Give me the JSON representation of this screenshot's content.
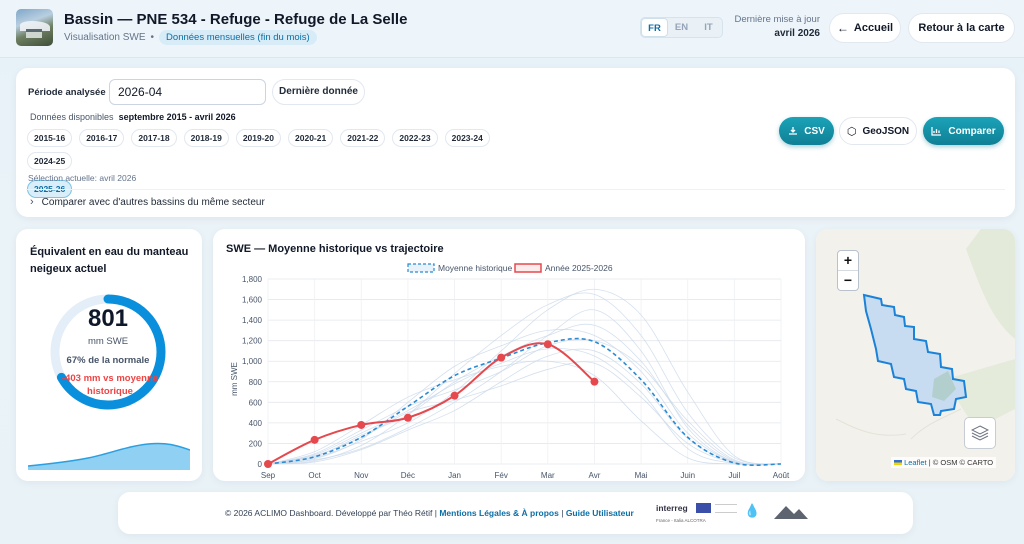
{
  "header": {
    "title": "Bassin — PNE 534 - Refuge - Refuge de La Selle",
    "subtitle": "Visualisation SWE",
    "subtitle_sep": "•",
    "mode_pill": "Données mensuelles (fin du mois)",
    "languages": [
      "FR",
      "EN",
      "IT"
    ],
    "active_language": "FR",
    "update_label": "Dernière mise à jour",
    "update_value": "avril 2026",
    "home_button": "Accueil",
    "back_button": "Retour à la carte"
  },
  "period": {
    "label": "Période analysée",
    "value": "2026-04",
    "last_data_button": "Dernière donnée",
    "available_label": "Données disponibles",
    "available_value": "septembre 2015 - avril 2026",
    "years": [
      "2015-16",
      "2016-17",
      "2017-18",
      "2018-19",
      "2019-20",
      "2020-21",
      "2021-22",
      "2022-23",
      "2023-24",
      "2024-25",
      "2025-26"
    ],
    "active_year": "2025-26",
    "selection_text": "Sélection actuelle: avril 2026",
    "compare_link": "Comparer avec d'autres bassins du même secteur",
    "csv_button": "CSV",
    "geojson_button": "GeoJSON",
    "compare_button": "Comparer"
  },
  "swe": {
    "title": "Équivalent en eau du manteau neigeux actuel",
    "value": "801",
    "unit": "mm SWE",
    "percent_normal": "67% de la normale",
    "gauge_fraction": 0.67,
    "delta": "-403 mm vs moyenne",
    "delta_suffix": "historique",
    "accent": "#0a8fdc",
    "delta_color": "#ef4444"
  },
  "chart": {
    "title": "SWE — Moyenne historique vs trajectoire"
  },
  "chart_data": {
    "type": "line",
    "ylabel": "mm SWE",
    "xlabel": "",
    "x": [
      "Sep",
      "Oct",
      "Nov",
      "Déc",
      "Jan",
      "Fév",
      "Mar",
      "Avr",
      "Mai",
      "Juin",
      "Juil",
      "Août"
    ],
    "ylim": [
      0,
      1800
    ],
    "yticks": [
      0,
      200,
      400,
      600,
      800,
      1000,
      1200,
      1400,
      1600,
      1800
    ],
    "grid": true,
    "legend": "top-center",
    "series": [
      {
        "name": "Moyenne historique",
        "style": "dashed",
        "color": "#2a8ad4",
        "values": [
          0,
          70,
          260,
          560,
          860,
          1030,
          1180,
          1190,
          820,
          260,
          10,
          0
        ]
      },
      {
        "name": "Année 2025-2026",
        "style": "solid",
        "color": "#e5484d",
        "values": [
          0,
          235,
          380,
          450,
          665,
          1035,
          1165,
          801
        ]
      }
    ],
    "background_series_color": "#c9d8ea",
    "background_series": [
      [
        0,
        40,
        150,
        350,
        600,
        900,
        1250,
        1500,
        1100,
        350,
        20,
        0
      ],
      [
        0,
        90,
        300,
        520,
        780,
        980,
        1120,
        1050,
        700,
        150,
        5,
        0
      ],
      [
        0,
        60,
        220,
        400,
        700,
        1100,
        1500,
        1700,
        1450,
        700,
        80,
        0
      ],
      [
        0,
        120,
        380,
        650,
        820,
        950,
        1000,
        860,
        420,
        60,
        0,
        0
      ],
      [
        0,
        30,
        180,
        480,
        880,
        1250,
        1550,
        1650,
        1250,
        500,
        60,
        0
      ],
      [
        0,
        80,
        260,
        500,
        620,
        760,
        920,
        980,
        650,
        200,
        10,
        0
      ],
      [
        0,
        50,
        240,
        600,
        950,
        1150,
        1300,
        1250,
        900,
        300,
        20,
        0
      ],
      [
        0,
        100,
        330,
        560,
        720,
        900,
        1150,
        1200,
        950,
        420,
        40,
        0
      ],
      [
        0,
        20,
        140,
        330,
        520,
        800,
        1050,
        1100,
        780,
        250,
        15,
        0
      ],
      [
        0,
        70,
        280,
        480,
        800,
        1050,
        1250,
        1350,
        1000,
        380,
        30,
        0
      ]
    ]
  },
  "map": {
    "zoom_in": "+",
    "zoom_out": "−",
    "attribution_link": "Leaflet",
    "attribution_text": "| © OSM © CARTO"
  },
  "footer": {
    "text": "© 2026 ACLIMO Dashboard. Développé par Théo Rétif |",
    "link_legal": "Mentions Légales & À propos",
    "sep": "|",
    "link_guide": "Guide Utilisateur",
    "logo_interreg": "interreg",
    "logo_interreg_sub": "France - Italia ALCOTRA"
  }
}
